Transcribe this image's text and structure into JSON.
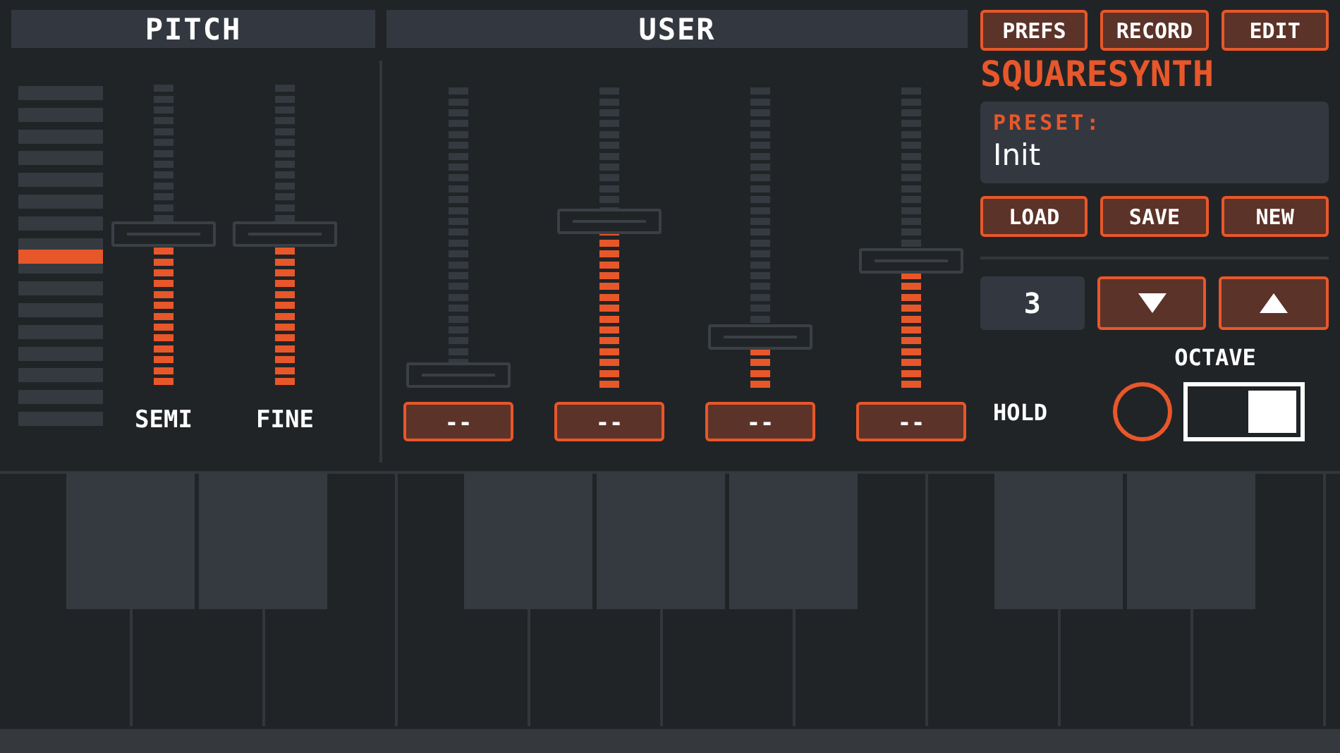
{
  "pitch": {
    "title": "PITCH",
    "bend_meter": {
      "level": 0.5
    },
    "sliders": [
      {
        "label": "SEMI",
        "level": 0.5
      },
      {
        "label": "FINE",
        "level": 0.5
      }
    ]
  },
  "user": {
    "title": "USER",
    "sliders": [
      {
        "level": 0.02,
        "button": "--"
      },
      {
        "level": 0.55,
        "button": "--"
      },
      {
        "level": 0.17,
        "button": "--"
      },
      {
        "level": 0.42,
        "button": "--"
      }
    ]
  },
  "top_buttons": [
    "PREFS",
    "RECORD",
    "EDIT"
  ],
  "app_title": "SQUARESYNTH",
  "preset": {
    "label": "PRESET:",
    "value": "Init"
  },
  "preset_buttons": [
    "LOAD",
    "SAVE",
    "NEW"
  ],
  "octave": {
    "value": "3",
    "label": "OCTAVE"
  },
  "hold": {
    "label": "HOLD",
    "active": false,
    "on": true
  }
}
